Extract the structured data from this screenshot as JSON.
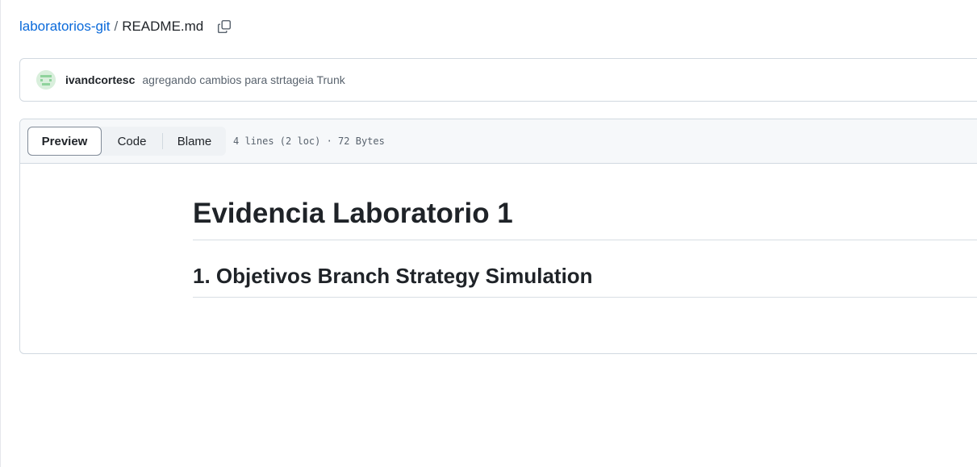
{
  "breadcrumb": {
    "repo": "laboratorios-git",
    "separator": "/",
    "file": "README.md",
    "copy_icon": "copy-icon"
  },
  "commit": {
    "avatar_icon": "avatar-icon",
    "author": "ivandcortesc",
    "message": "agregando cambios para strtageia Trunk"
  },
  "file_header": {
    "tabs": [
      {
        "label": "Preview",
        "active": true
      },
      {
        "label": "Code",
        "active": false
      },
      {
        "label": "Blame",
        "active": false
      }
    ],
    "meta": "4 lines (2 loc) · 72 Bytes"
  },
  "markdown": {
    "h1": "Evidencia Laboratorio 1",
    "h2": "1. Objetivos Branch Strategy Simulation"
  },
  "colors": {
    "link": "#0969da",
    "text": "#1f2328",
    "muted": "#59636e",
    "border": "#d1d9e0",
    "header_bg": "#f6f8fa"
  }
}
